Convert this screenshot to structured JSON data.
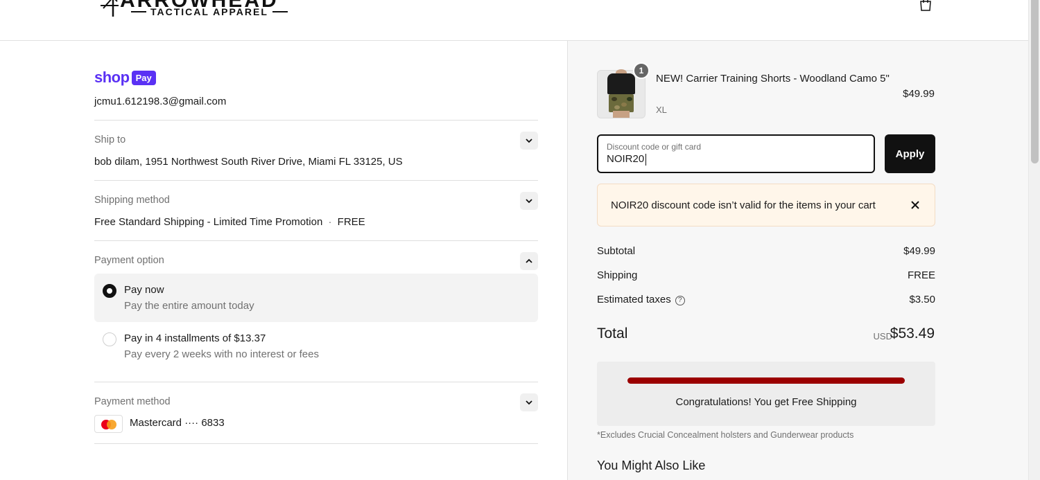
{
  "header": {
    "brand": "ARROWHEAD",
    "tagline": "TACTICAL APPAREL",
    "cart_icon": "shopping-bag-icon"
  },
  "contact": {
    "shop_label": "shop",
    "pay_label": "Pay",
    "email": "jcmu1.612198.3@gmail.com"
  },
  "ship_to": {
    "label": "Ship to",
    "value": "bob dilam, 1951 Northwest South River Drive, Miami FL 33125, US"
  },
  "shipping_method": {
    "label": "Shipping method",
    "value": "Free Standard Shipping - Limited Time Promotion",
    "separator": "·",
    "price": "FREE"
  },
  "payment_option": {
    "label": "Payment option",
    "options": [
      {
        "title": "Pay now",
        "subtitle": "Pay the entire amount today",
        "selected": true
      },
      {
        "title": "Pay in 4 installments of $13.37",
        "subtitle": "Pay every 2 weeks with no interest or fees",
        "selected": false
      }
    ]
  },
  "payment_method": {
    "label": "Payment method",
    "card": "Mastercard ···· 6833"
  },
  "order": {
    "item": {
      "quantity": "1",
      "name": "NEW! Carrier Training Shorts - Woodland Camo 5\"",
      "variant": "XL",
      "price": "$49.99"
    },
    "discount": {
      "placeholder": "Discount code or gift card",
      "value": "NOIR20",
      "apply_label": "Apply",
      "error": "NOIR20 discount code isn’t valid for the items in your cart"
    },
    "summary": {
      "subtotal_label": "Subtotal",
      "subtotal": "$49.99",
      "shipping_label": "Shipping",
      "shipping": "FREE",
      "taxes_label": "Estimated taxes",
      "taxes": "$3.50",
      "total_label": "Total",
      "currency": "USD",
      "total": "$53.49"
    },
    "promo": {
      "progress_percent": 100,
      "message": "Congratulations! You get Free Shipping",
      "accent_color": "#9b0000",
      "note": "*Excludes Crucial Concealment holsters and Gunderwear products"
    },
    "also_like": "You Might Also Like"
  }
}
